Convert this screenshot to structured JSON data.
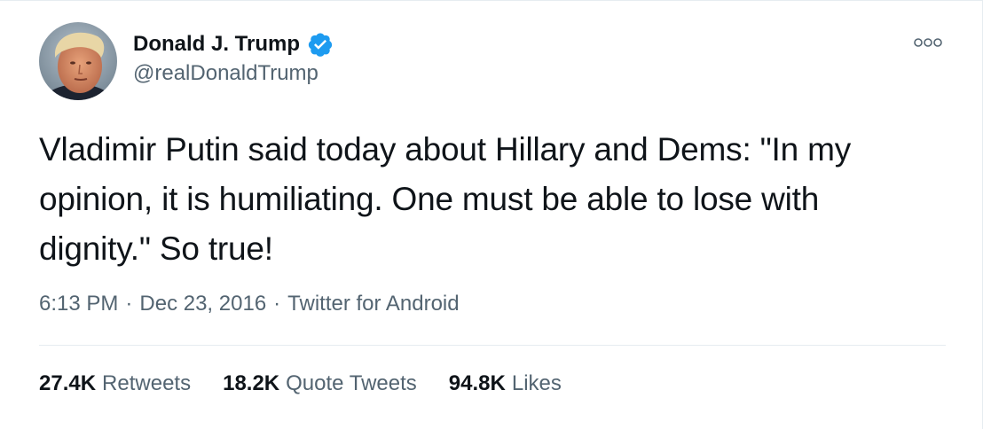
{
  "author": {
    "name": "Donald J. Trump",
    "handle": "@realDonaldTrump",
    "verified": true,
    "verified_color": "#1d9bf0"
  },
  "tweet": {
    "text": "Vladimir Putin said today about Hillary and Dems: \"In my\nopinion, it is humiliating. One must be able to lose with\ndignity.\"  So true!",
    "time": "6:13 PM",
    "date": "Dec 23, 2016",
    "source": "Twitter for Android",
    "separator": "·"
  },
  "stats": [
    {
      "count": "27.4K",
      "label": "Retweets"
    },
    {
      "count": "18.2K",
      "label": "Quote Tweets"
    },
    {
      "count": "94.8K",
      "label": "Likes"
    }
  ],
  "icons": {
    "more": "more-options-icon",
    "verified": "verified-badge-icon",
    "avatar": "profile-photo"
  }
}
